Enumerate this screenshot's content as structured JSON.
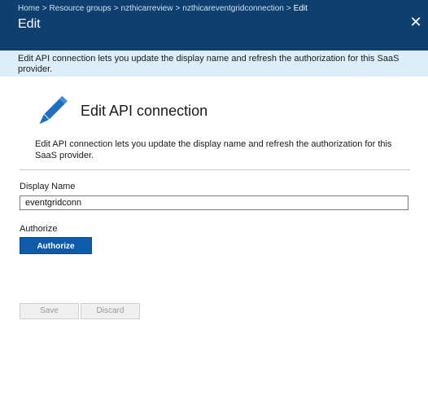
{
  "breadcrumb": {
    "items": [
      "Home",
      "Resource groups",
      "nzthicarreview",
      "nzthicareventgridconnection"
    ],
    "current": "Edit",
    "separator": ">"
  },
  "header": {
    "title": "Edit",
    "close_glyph": "✕",
    "close_icon": "close-icon"
  },
  "info_bar": {
    "message": "Edit API connection lets you update the display name and refresh the authorization for this SaaS provider."
  },
  "hero": {
    "icon": "pencil-icon",
    "title": "Edit API connection",
    "description": "Edit API connection lets you update the display name and refresh the authorization for this SaaS provider."
  },
  "form": {
    "display_name_label": "Display Name",
    "display_name_value": "eventgridconn",
    "authorize_label": "Authorize",
    "authorize_button": "Authorize"
  },
  "actions": {
    "save": "Save",
    "discard": "Discard"
  },
  "colors": {
    "header_bg": "#0f3f6e",
    "info_bg": "#dbeefa",
    "accent": "#0f5bab",
    "icon_blue": "#1e6fc2"
  }
}
